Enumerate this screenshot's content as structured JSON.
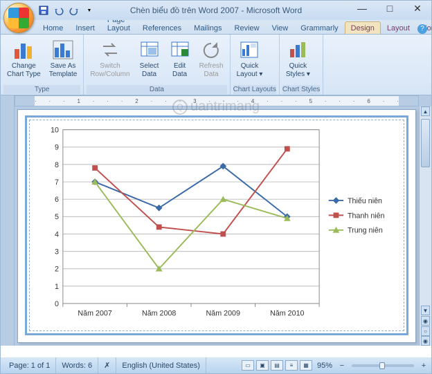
{
  "window": {
    "title": "Chèn biểu đồ trên Word 2007 - Microsoft Word",
    "min": "—",
    "max": "□",
    "close": "✕"
  },
  "qat": {
    "save_tip": "Save",
    "undo_tip": "Undo",
    "redo_tip": "Redo"
  },
  "tabs": {
    "items": [
      {
        "label": "Home"
      },
      {
        "label": "Insert"
      },
      {
        "label": "Page Layout"
      },
      {
        "label": "References"
      },
      {
        "label": "Mailings"
      },
      {
        "label": "Review"
      },
      {
        "label": "View"
      },
      {
        "label": "Grammarly"
      },
      {
        "label": "Design",
        "active": true,
        "ctx": true
      },
      {
        "label": "Layout",
        "ctx": true
      },
      {
        "label": "Format",
        "ctx": true
      }
    ]
  },
  "ribbon": {
    "groups": [
      {
        "label": "Type",
        "buttons": [
          {
            "label": "Change\nChart Type",
            "icon": "bar3d-icon"
          },
          {
            "label": "Save As\nTemplate",
            "icon": "bar-template-icon"
          }
        ]
      },
      {
        "label": "Data",
        "buttons": [
          {
            "label": "Switch\nRow/Column",
            "icon": "switch-icon",
            "disabled": true
          },
          {
            "label": "Select\nData",
            "icon": "select-data-icon"
          },
          {
            "label": "Edit\nData",
            "icon": "edit-data-icon"
          },
          {
            "label": "Refresh\nData",
            "icon": "refresh-icon",
            "disabled": true
          }
        ]
      },
      {
        "label": "Chart Layouts",
        "buttons": [
          {
            "label": "Quick\nLayout ▾",
            "icon": "layout-icon"
          }
        ]
      },
      {
        "label": "Chart Styles",
        "buttons": [
          {
            "label": "Quick\nStyles ▾",
            "icon": "styles-icon"
          }
        ]
      }
    ]
  },
  "ruler_ticks": [
    "·",
    "·",
    "·",
    "1",
    "·",
    "·",
    "·",
    "2",
    "·",
    "·",
    "·",
    "3",
    "·",
    "·",
    "·",
    "4",
    "·",
    "·",
    "·",
    "5",
    "·",
    "·",
    "·",
    "6",
    "·",
    "·"
  ],
  "status": {
    "page": "Page: 1 of 1",
    "words": "Words: 6",
    "lang": "English (United States)",
    "zoom": "95%",
    "zoom_minus": "−",
    "zoom_plus": "+"
  },
  "watermark": "uantrimang",
  "chart_data": {
    "type": "line",
    "categories": [
      "Năm 2007",
      "Năm 2008",
      "Năm 2009",
      "Năm 2010"
    ],
    "series": [
      {
        "name": "Thiếu niên",
        "color": "#3a6aa8",
        "values": [
          7.0,
          5.5,
          7.9,
          5.0
        ]
      },
      {
        "name": "Thanh niên",
        "color": "#c0504d",
        "values": [
          7.8,
          4.4,
          4.0,
          8.9
        ]
      },
      {
        "name": "Trung niên",
        "color": "#9bbb59",
        "values": [
          7.0,
          2.0,
          6.0,
          4.9
        ]
      }
    ],
    "ylim": [
      0,
      10
    ],
    "yticks": [
      0,
      1,
      2,
      3,
      4,
      5,
      6,
      7,
      8,
      9,
      10
    ],
    "xlabel": "",
    "ylabel": "",
    "title": "",
    "legend_pos": "right"
  }
}
